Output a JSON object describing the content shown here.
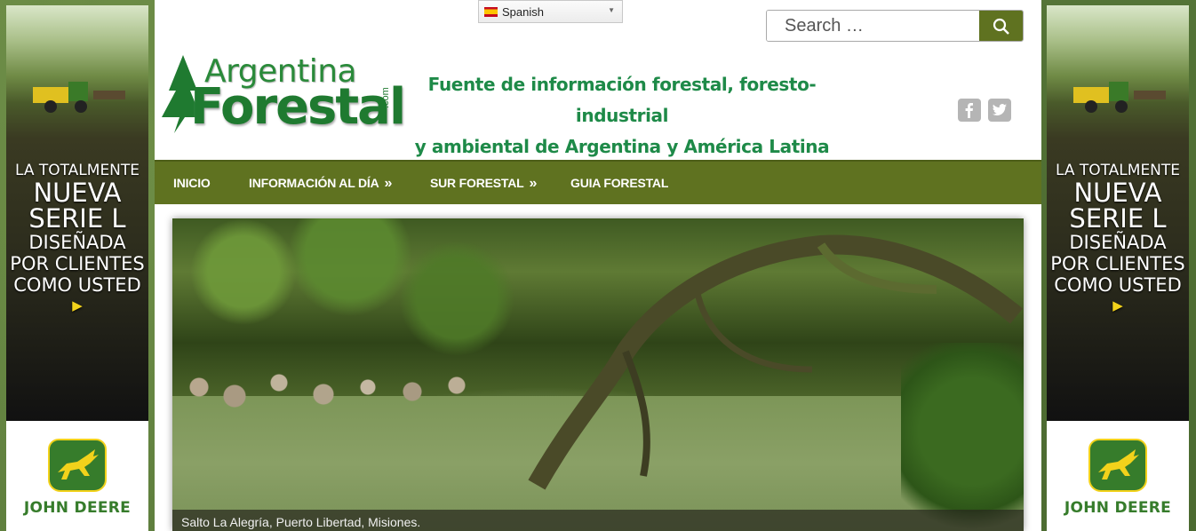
{
  "ad": {
    "line1": "LA TOTALMENTE",
    "line2": "NUEVA",
    "line3": "SERIE L",
    "line4": "DISEÑADA",
    "line5": "POR CLIENTES",
    "line6": "COMO USTED",
    "brand": "JOHN DEERE",
    "arrow_color": "#f2d21b",
    "brand_color": "#367c2b"
  },
  "language": {
    "selected": "Spanish",
    "flag_icon": "spain-flag-icon"
  },
  "search": {
    "placeholder": "Search …",
    "icon": "search-icon"
  },
  "logo": {
    "line1": "Argentina",
    "line2": "Forestal",
    "suffix": ".com"
  },
  "tagline": {
    "line1": "Fuente de información forestal, foresto-industrial",
    "line2": "y ambiental de Argentina y América Latina"
  },
  "social": [
    "facebook-icon",
    "twitter-icon"
  ],
  "nav": {
    "items": [
      {
        "label": "INICIO",
        "submenu": false
      },
      {
        "label": "INFORMACIÓN AL DÍA",
        "submenu": true
      },
      {
        "label": "SUR FORESTAL",
        "submenu": true
      },
      {
        "label": "GUIA FORESTAL",
        "submenu": false
      }
    ],
    "submenu_marker": "»"
  },
  "slider": {
    "caption": "Salto La Alegría, Puerto Libertad, Misiones."
  },
  "colors": {
    "nav_bg": "#5f7220",
    "tagline": "#1e8a48",
    "logo_green": "#1f7a30",
    "social_grey": "#b5b5b5"
  }
}
